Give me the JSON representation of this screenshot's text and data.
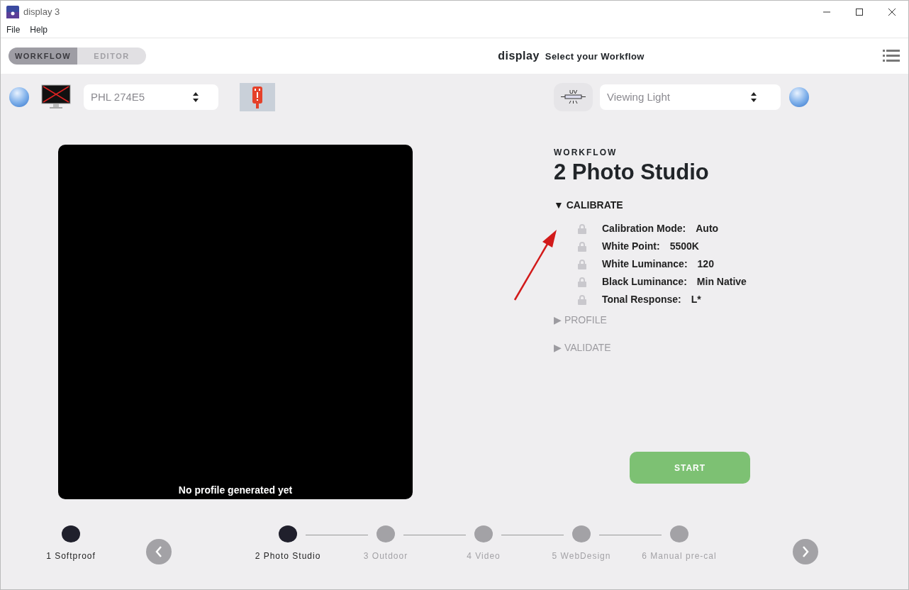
{
  "window": {
    "title": "display 3"
  },
  "menu": [
    "File",
    "Help"
  ],
  "mode_tabs": [
    {
      "label": "WORKFLOW",
      "selected": true
    },
    {
      "label": "EDITOR",
      "selected": false
    }
  ],
  "header": {
    "app": "display",
    "subtitle": "Select your Workflow"
  },
  "display_select": {
    "value": "PHL 274E5"
  },
  "uv_button": {
    "label": "UV"
  },
  "light_select": {
    "placeholder": "Viewing Light"
  },
  "preview": {
    "caption": "No profile generated yet"
  },
  "workflow": {
    "label": "WORKFLOW",
    "title": "2 Photo Studio",
    "sections": [
      {
        "marker": "▼",
        "label": "CALIBRATE",
        "expanded": true,
        "items": [
          {
            "name": "Calibration Mode:",
            "value": "Auto"
          },
          {
            "name": "White Point:",
            "value": "5500K"
          },
          {
            "name": "White Luminance:",
            "value": "120"
          },
          {
            "name": "Black Luminance:",
            "value": "Min Native"
          },
          {
            "name": "Tonal Response:",
            "value": "L*"
          }
        ]
      },
      {
        "marker": "▶",
        "label": "PROFILE",
        "expanded": false
      },
      {
        "marker": "▶",
        "label": "VALIDATE",
        "expanded": false
      }
    ]
  },
  "start_button": "START",
  "steps": [
    {
      "label": "1 Softproof",
      "active": true
    },
    {
      "label": "2 Photo Studio",
      "active": true
    },
    {
      "label": "3 Outdoor",
      "active": false
    },
    {
      "label": "4 Video",
      "active": false
    },
    {
      "label": "5 WebDesign",
      "active": false
    },
    {
      "label": "6 Manual pre-cal",
      "active": false
    }
  ]
}
